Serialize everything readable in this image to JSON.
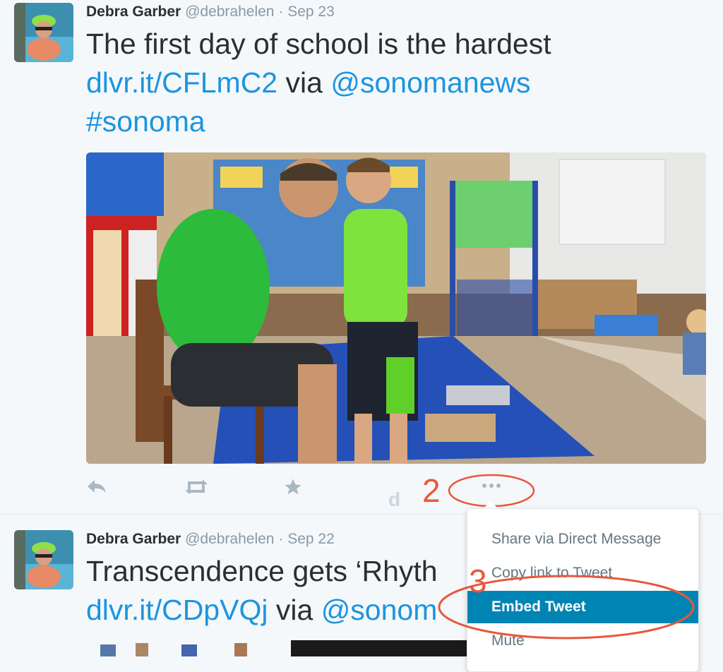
{
  "tweets": [
    {
      "fullname": "Debra Garber",
      "username": "@debrahelen",
      "separator": "·",
      "time": "Sep 23",
      "text_plain": "The first day of school is the hardest",
      "link": "dlvr.it/CFLmC2",
      "via": "via",
      "mention": "@sonomanews",
      "hashtag": "#sonoma"
    },
    {
      "fullname": "Debra Garber",
      "username": "@debrahelen",
      "separator": "·",
      "time": "Sep 22",
      "text_plain": "Transcendence gets ‘Rhyth",
      "link": "dlvr.it/CDpVQj",
      "via": "via",
      "mention": "@sonom"
    }
  ],
  "actions": {
    "reply_icon": "reply-icon",
    "retweet_icon": "retweet-icon",
    "favorite_icon": "star-icon",
    "more_icon": "more-dots-icon",
    "stray_letter": "d"
  },
  "annotations": {
    "step2": "2",
    "step3": "3",
    "color": "#e8583b"
  },
  "menu": {
    "items": [
      {
        "label": "Share via Direct Message"
      },
      {
        "label": "Copy link to Tweet"
      },
      {
        "label": "Embed Tweet"
      },
      {
        "label": "Mute"
      }
    ],
    "active_index": 2,
    "active_color": "#0084b4"
  },
  "colors": {
    "link": "#1b95e0",
    "muted": "#8899a6",
    "icon": "#aab8c2"
  }
}
